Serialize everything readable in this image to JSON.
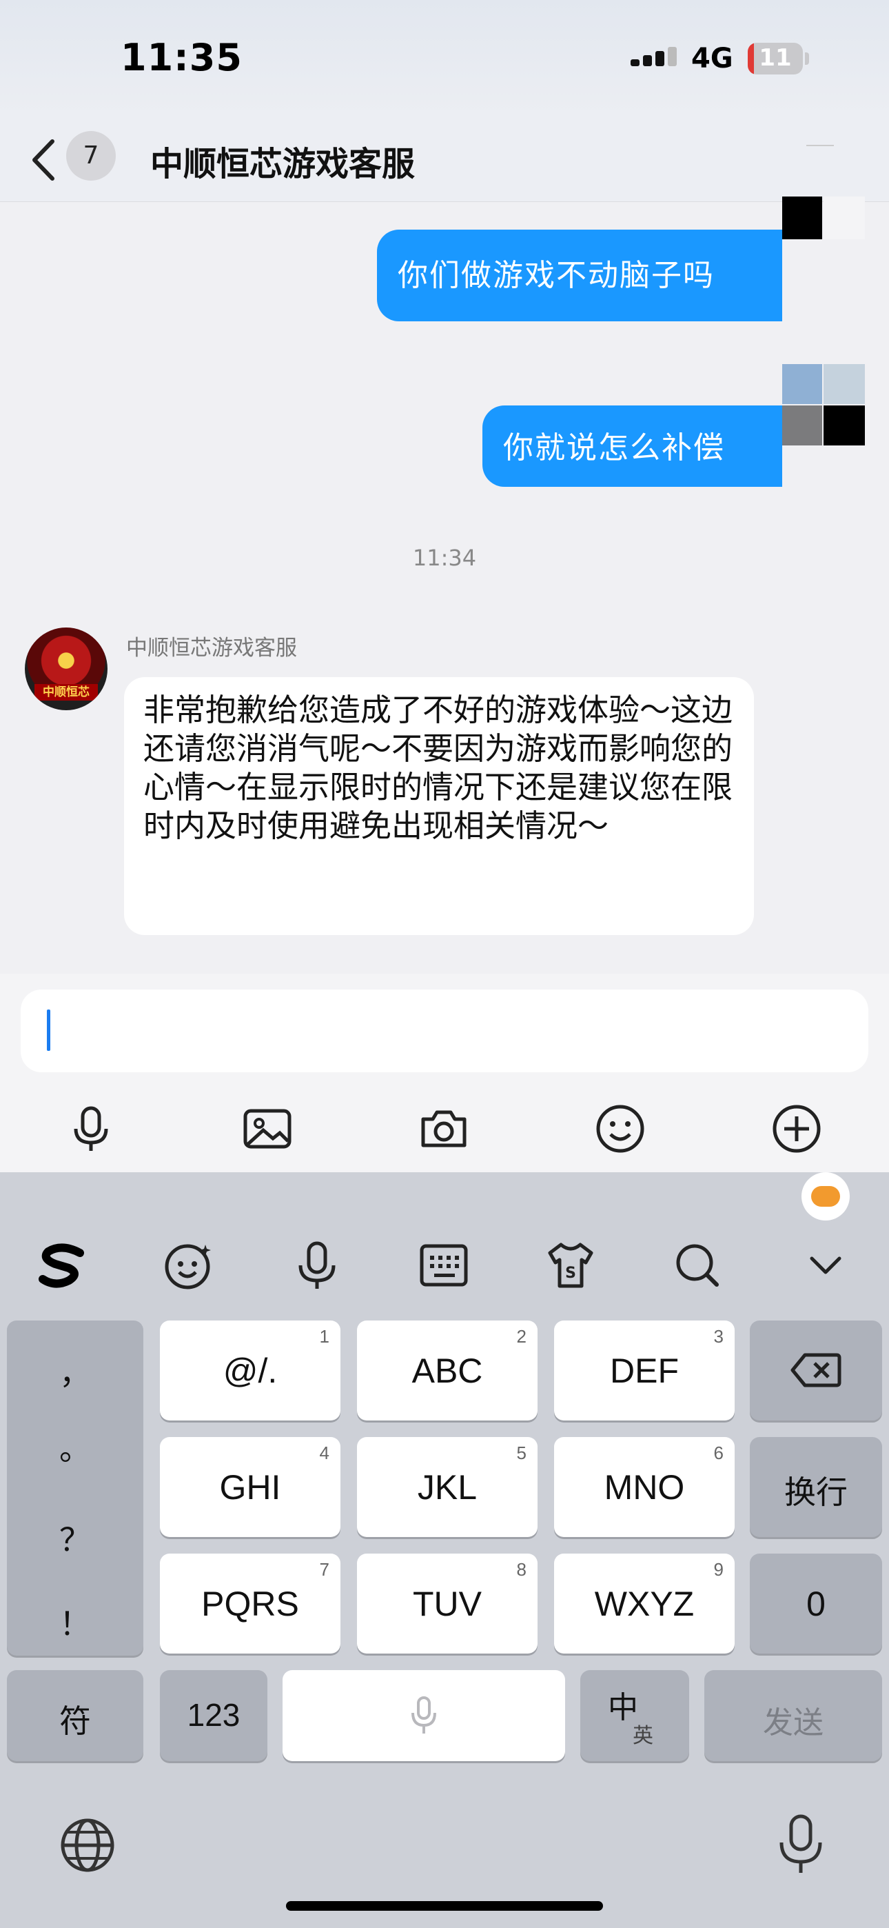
{
  "status_bar": {
    "time": "11:35",
    "network": "4G",
    "battery_level": "11",
    "battery_fraction": 0.11
  },
  "header": {
    "unread_count": "7",
    "title": "中顺恒芯游戏客服"
  },
  "messages": {
    "sent": [
      "你们做游戏不动脑子吗",
      "你就说怎么补偿"
    ],
    "timestamp": "11:34",
    "sender_name": "中顺恒芯游戏客服",
    "avatar_label": "中顺恒芯",
    "received": "非常抱歉给您造成了不好的游戏体验～这边还请您消消气呢～不要因为游戏而影响您的心情～在显示限时的情况下还是建议您在限时内及时使用避免出现相关情况～"
  },
  "input": {
    "value": ""
  },
  "toolbar_icons": [
    "microphone-icon",
    "image-icon",
    "camera-icon",
    "emoji-icon",
    "plus-icon"
  ],
  "keyboard": {
    "toolbar_icons": [
      "sogou-logo-icon",
      "emoji-icon",
      "voice-icon",
      "keyboard-icon",
      "skin-icon",
      "search-icon",
      "collapse-icon"
    ],
    "punctuation": [
      "，",
      "。",
      "？",
      "！"
    ],
    "keys": [
      {
        "label": "@/.",
        "num": "1"
      },
      {
        "label": "ABC",
        "num": "2"
      },
      {
        "label": "DEF",
        "num": "3"
      },
      {
        "label": "GHI",
        "num": "4"
      },
      {
        "label": "JKL",
        "num": "5"
      },
      {
        "label": "MNO",
        "num": "6"
      },
      {
        "label": "PQRS",
        "num": "7"
      },
      {
        "label": "TUV",
        "num": "8"
      },
      {
        "label": "WXYZ",
        "num": "9"
      }
    ],
    "enter_label": "换行",
    "zero_label": "0",
    "symbol_label": "符",
    "number_label": "123",
    "lang_main": "中",
    "lang_alt": "英",
    "send_label": "发送"
  }
}
